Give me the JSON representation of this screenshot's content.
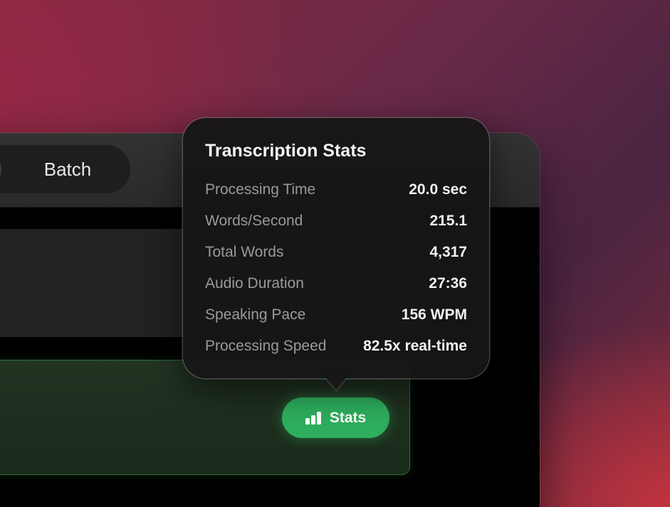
{
  "toolbar": {
    "segments": [
      {
        "label": "Batch"
      }
    ]
  },
  "stats_button": {
    "label": "Stats",
    "icon": "bar-chart-icon",
    "color": "#2eaf5e"
  },
  "popover": {
    "title": "Transcription Stats",
    "rows": [
      {
        "label": "Processing Time",
        "value": "20.0 sec"
      },
      {
        "label": "Words/Second",
        "value": "215.1"
      },
      {
        "label": "Total Words",
        "value": "4,317"
      },
      {
        "label": "Audio Duration",
        "value": "27:36"
      },
      {
        "label": "Speaking Pace",
        "value": "156 WPM"
      },
      {
        "label": "Processing Speed",
        "value": "82.5x real-time"
      }
    ]
  }
}
